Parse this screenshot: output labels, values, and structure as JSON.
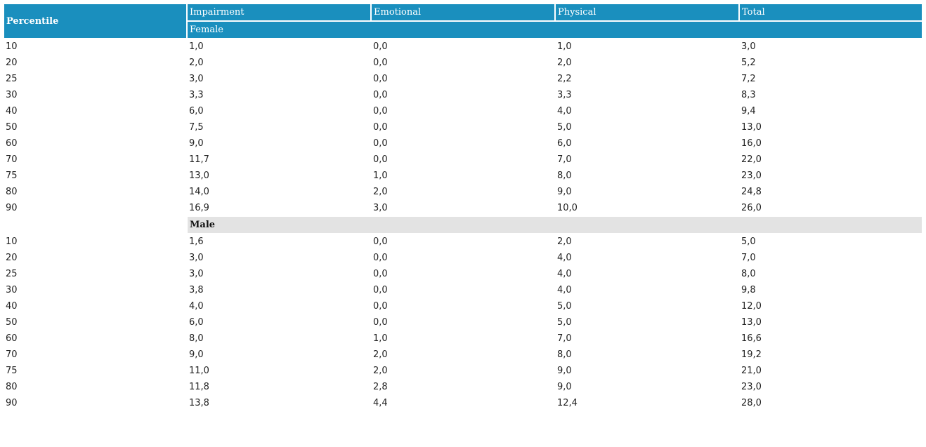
{
  "header": {
    "percentile_label": "Percentile",
    "columns": [
      "Impairment",
      "Emotional",
      "Physical",
      "Total"
    ],
    "colors": {
      "header_bg": "#1a8fbe",
      "header_text": "#ffffff",
      "group_bg": "#e3e3e3"
    }
  },
  "groups": [
    {
      "label": "Female",
      "rows": [
        {
          "p": "10",
          "impairment": "1,0",
          "emotional": "0,0",
          "physical": "1,0",
          "total": "3,0"
        },
        {
          "p": "20",
          "impairment": "2,0",
          "emotional": "0,0",
          "physical": "2,0",
          "total": "5,2"
        },
        {
          "p": "25",
          "impairment": "3,0",
          "emotional": "0,0",
          "physical": "2,2",
          "total": "7,2"
        },
        {
          "p": "30",
          "impairment": "3,3",
          "emotional": "0,0",
          "physical": "3,3",
          "total": "8,3"
        },
        {
          "p": "40",
          "impairment": "6,0",
          "emotional": "0,0",
          "physical": "4,0",
          "total": "9,4"
        },
        {
          "p": "50",
          "impairment": "7,5",
          "emotional": "0,0",
          "physical": "5,0",
          "total": "13,0"
        },
        {
          "p": "60",
          "impairment": "9,0",
          "emotional": "0,0",
          "physical": "6,0",
          "total": "16,0"
        },
        {
          "p": "70",
          "impairment": "11,7",
          "emotional": "0,0",
          "physical": "7,0",
          "total": "22,0"
        },
        {
          "p": "75",
          "impairment": "13,0",
          "emotional": "1,0",
          "physical": "8,0",
          "total": "23,0"
        },
        {
          "p": "80",
          "impairment": "14,0",
          "emotional": "2,0",
          "physical": "9,0",
          "total": "24,8"
        },
        {
          "p": "90",
          "impairment": "16,9",
          "emotional": "3,0",
          "physical": "10,0",
          "total": "26,0"
        }
      ]
    },
    {
      "label": "Male",
      "rows": [
        {
          "p": "10",
          "impairment": "1,6",
          "emotional": "0,0",
          "physical": "2,0",
          "total": "5,0"
        },
        {
          "p": "20",
          "impairment": "3,0",
          "emotional": "0,0",
          "physical": "4,0",
          "total": "7,0"
        },
        {
          "p": "25",
          "impairment": "3,0",
          "emotional": "0,0",
          "physical": "4,0",
          "total": "8,0"
        },
        {
          "p": "30",
          "impairment": "3,8",
          "emotional": "0,0",
          "physical": "4,0",
          "total": "9,8"
        },
        {
          "p": "40",
          "impairment": "4,0",
          "emotional": "0,0",
          "physical": "5,0",
          "total": "12,0"
        },
        {
          "p": "50",
          "impairment": "6,0",
          "emotional": "0,0",
          "physical": "5,0",
          "total": "13,0"
        },
        {
          "p": "60",
          "impairment": "8,0",
          "emotional": "1,0",
          "physical": "7,0",
          "total": "16,6"
        },
        {
          "p": "70",
          "impairment": "9,0",
          "emotional": "2,0",
          "physical": "8,0",
          "total": "19,2"
        },
        {
          "p": "75",
          "impairment": "11,0",
          "emotional": "2,0",
          "physical": "9,0",
          "total": "21,0"
        },
        {
          "p": "80",
          "impairment": "11,8",
          "emotional": "2,8",
          "physical": "9,0",
          "total": "23,0"
        },
        {
          "p": "90",
          "impairment": "13,8",
          "emotional": "4,4",
          "physical": "12,4",
          "total": "28,0"
        }
      ]
    }
  ]
}
